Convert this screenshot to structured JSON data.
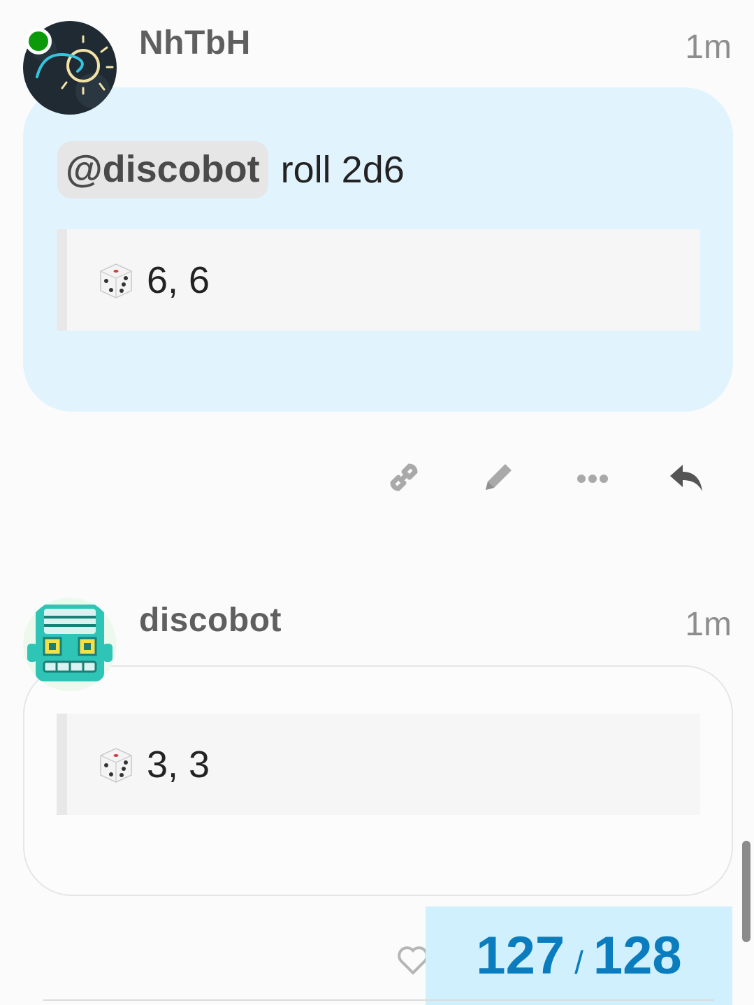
{
  "posts": [
    {
      "username": "NhTbH",
      "time": "1m",
      "mention": "@discobot",
      "text": "roll 2d6",
      "roll_result": "6, 6",
      "online": true
    },
    {
      "username": "discobot",
      "time": "1m",
      "roll_result": "3, 3"
    }
  ],
  "post_actions": {
    "icons": [
      "link-icon",
      "pencil-icon",
      "more-icon",
      "reply-icon"
    ]
  },
  "progress": {
    "current": "127",
    "separator": "/",
    "total": "128"
  },
  "colors": {
    "user_bubble": "#e1f4fd",
    "progress_bg": "#d1f0fd",
    "progress_text": "#0b7dbe",
    "online": "#0a9a0a"
  }
}
